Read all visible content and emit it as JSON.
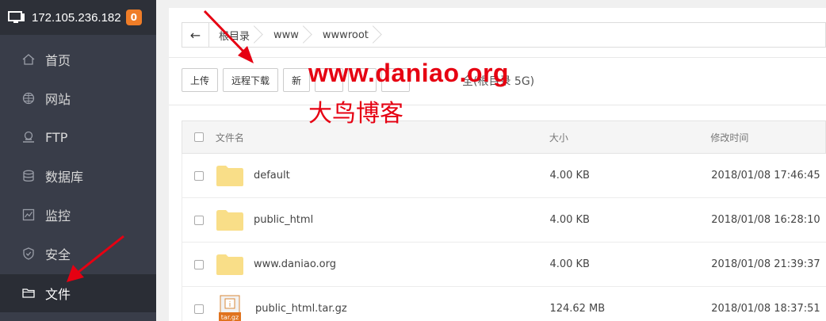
{
  "sidebar": {
    "server_ip": "172.105.236.182",
    "badge_count": "0",
    "items": [
      {
        "label": "首页",
        "icon": "home-icon"
      },
      {
        "label": "网站",
        "icon": "globe-icon"
      },
      {
        "label": "FTP",
        "icon": "ftp-icon"
      },
      {
        "label": "数据库",
        "icon": "database-icon"
      },
      {
        "label": "监控",
        "icon": "monitor-chart-icon"
      },
      {
        "label": "安全",
        "icon": "shield-icon"
      },
      {
        "label": "文件",
        "icon": "folder-icon",
        "active": true
      }
    ]
  },
  "breadcrumb": {
    "items": [
      "根目录",
      "www",
      "wwwroot"
    ]
  },
  "toolbar": {
    "upload_label": "上传",
    "remote_download_label": "远程下载",
    "new_label": "新",
    "disk_info": "全(根目录 5G)"
  },
  "watermark": {
    "line1": "www.daniao.org",
    "line2": "大鸟博客"
  },
  "table": {
    "headers": {
      "name": "文件名",
      "size": "大小",
      "modified": "修改时间"
    },
    "rows": [
      {
        "name": "default",
        "size": "4.00 KB",
        "modified": "2018/01/08 17:46:45",
        "type": "folder"
      },
      {
        "name": "public_html",
        "size": "4.00 KB",
        "modified": "2018/01/08 16:28:10",
        "type": "folder"
      },
      {
        "name": "www.daniao.org",
        "size": "4.00 KB",
        "modified": "2018/01/08 21:39:37",
        "type": "folder"
      },
      {
        "name": "public_html.tar.gz",
        "size": "124.62 MB",
        "modified": "2018/01/08 18:37:51",
        "type": "archive",
        "icon_label": "tar.gz"
      }
    ]
  },
  "colors": {
    "sidebar_bg": "#393d49",
    "accent_red": "#e60012",
    "badge": "#ef7d28",
    "folder": "#f9de88"
  }
}
